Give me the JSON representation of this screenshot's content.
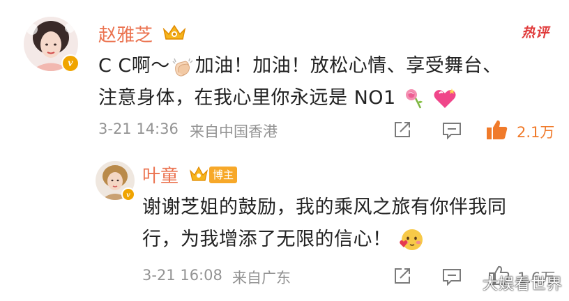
{
  "comments": [
    {
      "author": "赵雅芝",
      "text_line1": "C C啊～",
      "text_line1b": "加油！加油！放松心情、享受舞台、",
      "text_line2": "注意身体，在我心里你永远是 NO1",
      "date": "3-21 14:36",
      "source": "来自中国香港",
      "likes": "2.1万",
      "hot_label": "热评",
      "icons": [
        "share-icon",
        "comment-icon",
        "like-icon"
      ],
      "emoji": [
        "clapping-hands-emoji",
        "rose-emoji",
        "heart-emoji"
      ]
    },
    {
      "author": "叶童",
      "badge": "博主",
      "text_line1": "谢谢芝姐的鼓励，我的乘风之旅有你伴我同",
      "text_line2": "行，为我增添了无限的信心！",
      "date": "3-21 16:08",
      "source": "来自广东",
      "likes": "1.6万",
      "icons": [
        "share-icon",
        "comment-icon",
        "like-icon"
      ],
      "emoji": [
        "blushing-face-emoji"
      ]
    }
  ],
  "watermark": "大娱看世界",
  "colors": {
    "name": "#eb7350",
    "text": "#222222",
    "meta": "#939393",
    "like_active": "#f07a2a",
    "badge": "#f7a829",
    "hot": "#e03a3a"
  }
}
